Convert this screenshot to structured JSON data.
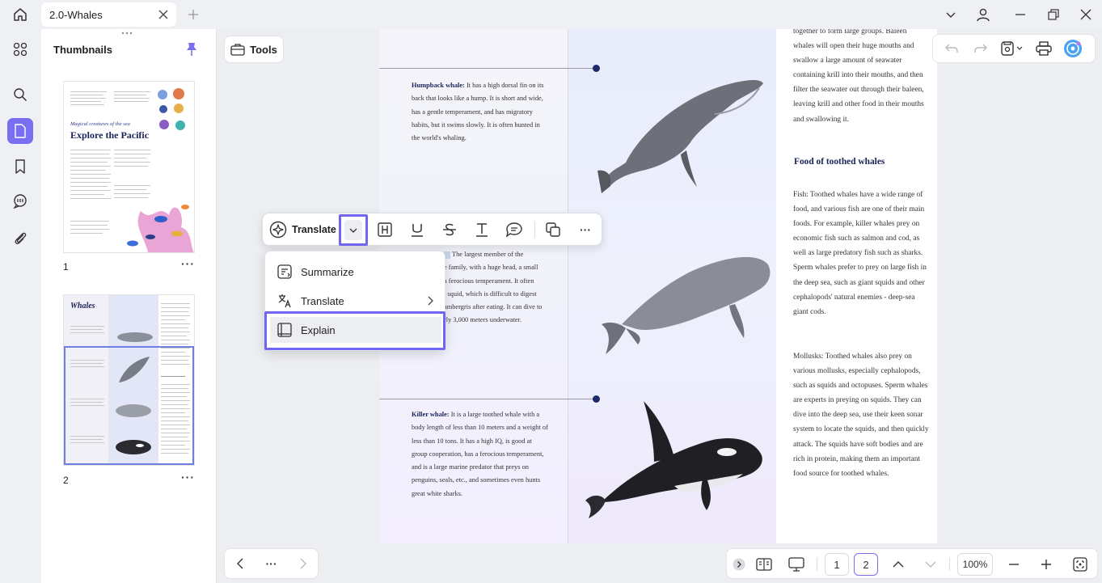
{
  "window": {
    "tab_title": "2.0-Whales"
  },
  "sidebar_panel": {
    "title": "Thumbnails",
    "pages": [
      {
        "number": "1",
        "title": "Explore the Pacific",
        "subtitle": "Magical creatures of the sea"
      },
      {
        "number": "2",
        "title": "Whales"
      }
    ]
  },
  "toolbar": {
    "tools_label": "Tools"
  },
  "floating_toolbar": {
    "translate_label": "Translate"
  },
  "ai_menu": {
    "items": [
      {
        "label": "Summarize",
        "icon": "summarize-icon"
      },
      {
        "label": "Translate",
        "icon": "translate-icon",
        "has_submenu": true
      },
      {
        "label": "Explain",
        "icon": "explain-icon",
        "highlighted": true
      }
    ]
  },
  "document": {
    "humpback": {
      "name": "Humpback whale:",
      "text": "It has a high dorsal fin on its back that looks like a hump. It is short and wide, has a gentle temperament, and has migratory habits, but it swims slowly. It is often hunted in the world's whaling."
    },
    "sperm": {
      "text_lines": [
        "The largest member of the",
        "e family, with a huge head, a small",
        "a ferocious temperament. It often",
        "t squid, which is difficult to digest",
        "ambergris after eating. It can dive to",
        "rly 3,000 meters underwater."
      ]
    },
    "killer": {
      "name": "Killer whale:",
      "text": "It is a large toothed whale with a body length of less than 10 meters and a weight of less than 10 tons. It has a high IQ, is good at group cooperation, has a ferocious temperament, and is a large marine predator that preys on penguins, seals, etc., and sometimes even hunts great white sharks."
    },
    "right_column_intro": "together to form large groups. Baleen whales will open their huge mouths and swallow a large amount of seawater containing krill into their mouths, and then filter the seawater out through their baleen, leaving krill and other food in their mouths and swallowing it.",
    "food_heading": "Food of toothed whales",
    "food_text": "Fish: Toothed whales have a wide range of food, and various fish are one of their main foods. For example, killer whales prey on economic fish such as salmon and cod, as well as large predatory fish such as sharks. Sperm whales prefer to prey on large fish in the deep sea, such as giant squids and other cephalopods' natural enemies - deep-sea giant cods.",
    "mollusks_text": "Mollusks: Toothed whales also prey on various mollusks, especially cephalopods, such as squids and octopuses. Sperm whales are experts in preying on squids. They can dive into the deep sea, use their keen sonar system to locate the squids, and then quickly attack. The squids have soft bodies and are rich in protein, making them an important food source for toothed whales."
  },
  "bottom_bar": {
    "more_label": "···",
    "page_1": "1",
    "page_2": "2",
    "zoom": "100%"
  },
  "colors": {
    "accent": "#7a6ff0",
    "highlight_border": "#6f67f2",
    "heading_navy": "#1c2358"
  }
}
